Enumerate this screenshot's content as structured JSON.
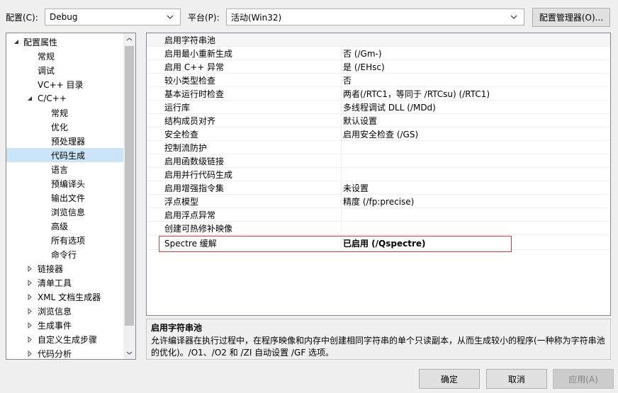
{
  "header": {
    "config_label": "配置(C):",
    "config_value": "Debug",
    "platform_label": "平台(P):",
    "platform_value": "活动(Win32)",
    "config_manager_label": "配置管理器(O)..."
  },
  "tree": {
    "items": [
      {
        "label": "配置属性",
        "level": 0,
        "arrow": "expanded"
      },
      {
        "label": "常规",
        "level": 1
      },
      {
        "label": "调试",
        "level": 1
      },
      {
        "label": "VC++ 目录",
        "level": 1
      },
      {
        "label": "C/C++",
        "level": 1,
        "arrow": "expanded"
      },
      {
        "label": "常规",
        "level": 2
      },
      {
        "label": "优化",
        "level": 2
      },
      {
        "label": "预处理器",
        "level": 2
      },
      {
        "label": "代码生成",
        "level": 2,
        "selected": true
      },
      {
        "label": "语言",
        "level": 2
      },
      {
        "label": "预编译头",
        "level": 2
      },
      {
        "label": "输出文件",
        "level": 2
      },
      {
        "label": "浏览信息",
        "level": 2
      },
      {
        "label": "高级",
        "level": 2
      },
      {
        "label": "所有选项",
        "level": 2
      },
      {
        "label": "命令行",
        "level": 2
      },
      {
        "label": "链接器",
        "level": 1,
        "arrow": "collapsed"
      },
      {
        "label": "清单工具",
        "level": 1,
        "arrow": "collapsed"
      },
      {
        "label": "XML 文档生成器",
        "level": 1,
        "arrow": "collapsed"
      },
      {
        "label": "浏览信息",
        "level": 1,
        "arrow": "collapsed"
      },
      {
        "label": "生成事件",
        "level": 1,
        "arrow": "collapsed"
      },
      {
        "label": "自定义生成步骤",
        "level": 1,
        "arrow": "collapsed"
      },
      {
        "label": "代码分析",
        "level": 1,
        "arrow": "collapsed"
      }
    ]
  },
  "grid": {
    "rows": [
      {
        "name": "启用字符串池",
        "value": ""
      },
      {
        "name": "启用最小重新生成",
        "value": "否 (/Gm-)"
      },
      {
        "name": "启用 C++ 异常",
        "value": "是 (/EHsc)"
      },
      {
        "name": "较小类型检查",
        "value": "否"
      },
      {
        "name": "基本运行时检查",
        "value": "两者(/RTC1，等同于 /RTCsu) (/RTC1)"
      },
      {
        "name": "运行库",
        "value": "多线程调试 DLL (/MDd)"
      },
      {
        "name": "结构成员对齐",
        "value": "默认设置"
      },
      {
        "name": "安全检查",
        "value": "启用安全检查 (/GS)"
      },
      {
        "name": "控制流防护",
        "value": ""
      },
      {
        "name": "启用函数级链接",
        "value": ""
      },
      {
        "name": "启用并行代码生成",
        "value": ""
      },
      {
        "name": "启用增强指令集",
        "value": "未设置"
      },
      {
        "name": "浮点模型",
        "value": "精度 (/fp:precise)"
      },
      {
        "name": "启用浮点异常",
        "value": ""
      },
      {
        "name": "创建可热修补映像",
        "value": ""
      },
      {
        "name": "Spectre 缓解",
        "value": "已启用 (/Qspectre)",
        "bold": true
      }
    ]
  },
  "description": {
    "title": "启用字符串池",
    "body": "允许编译器在执行过程中，在程序映像和内存中创建相同字符串的单个只读副本，从而生成较小的程序(一种称为字符串池的优化)。/O1、/O2 和 /ZI 自动设置 /GF 选项。"
  },
  "footer": {
    "ok_label": "确定",
    "cancel_label": "取消",
    "apply_label": "应用(A)"
  },
  "colors": {
    "selected_bg": "#cce4f7",
    "highlight_border": "#d83b3b",
    "disabled_text": "#838383"
  }
}
